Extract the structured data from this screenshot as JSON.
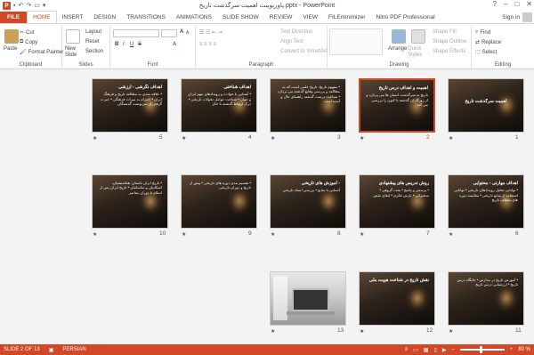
{
  "titlebar": {
    "title": "پاورپوینت اهمیت سرگذشت تاریخ.pptx - PowerPoint",
    "logo": "P",
    "buttons": [
      "?",
      "–",
      "□",
      "✕"
    ]
  },
  "tabs": [
    "FILE",
    "HOME",
    "INSERT",
    "DESIGN",
    "TRANSITIONS",
    "ANIMATIONS",
    "SLIDE SHOW",
    "REVIEW",
    "VIEW",
    "FILEminimizer",
    "Nitro PDF Professional"
  ],
  "active_tab": "HOME",
  "signin": "Sign in",
  "ribbon": {
    "clipboard": {
      "paste": "Paste",
      "cut": "Cut",
      "copy": "Copy",
      "format_painter": "Format Painter",
      "label": "Clipboard"
    },
    "slides": {
      "new_slide": "New Slide",
      "layout": "Layout",
      "reset": "Reset",
      "section": "Section",
      "label": "Slides"
    },
    "font": {
      "label": "Font",
      "bold": "B",
      "italic": "I",
      "underline": "U",
      "strike": "S",
      "grow": "A",
      "shrink": "A",
      "clear": "A"
    },
    "paragraph": {
      "text_direction": "Text Direction",
      "align_text": "Align Text",
      "convert_smartart": "Convert to SmartArt",
      "label": "Paragraph"
    },
    "drawing": {
      "arrange": "Arrange",
      "quick_styles": "Quick Styles",
      "shape_fill": "Shape Fill",
      "shape_outline": "Shape Outline",
      "shape_effects": "Shape Effects",
      "label": "Drawing"
    },
    "editing": {
      "find": "Find",
      "replace": "Replace",
      "select": "Select",
      "label": "Editing"
    }
  },
  "slides": [
    {
      "num": "1",
      "type": "cover",
      "title": "اهمیت سرگذشت تاریخ",
      "body": ""
    },
    {
      "num": "2",
      "type": "text",
      "title": "اهمیت و اهداف درس تاریخ",
      "body": "تاریخ به سرگذشت انسان ها می پردازد و از روزگاران گذشته تا کنون را بررسی می کند"
    },
    {
      "num": "3",
      "type": "text",
      "title": "",
      "body": "• مفهوم تاریخ: تاریخ علمی است که به مطالعه و بررسی وقایع گذشته می پردازد • شناخت درست گذشته راهنمای حال و آینده است"
    },
    {
      "num": "4",
      "type": "text",
      "title": "اهداف شناختی",
      "body": "• آشنایی با حوادث و رویدادهای مهم ایران و جهان • شناخت عوامل تحولات تاریخی • درک ارتباط گذشته با حال"
    },
    {
      "num": "5",
      "type": "text",
      "title": "اهداف نگرشی - ارزشی",
      "body": "• علاقه مندی به مطالعه تاریخ و فرهنگ ایران • احترام به میراث فرهنگی • عبرت گرفتن از سرنوشت گذشتگان"
    },
    {
      "num": "6",
      "type": "text",
      "title": "اهداف مهارتی - محتوایی",
      "body": "• توانایی تحلیل رویدادهای تاریخی • توانایی استفاده از منابع تاریخی • مقایسه دوره های مختلف تاریخ"
    },
    {
      "num": "7",
      "type": "text",
      "title": "روش تدریس های پیشنهادی",
      "body": "• پرسش و پاسخ • بحث گروهی • سخنرانی • بارش فکری • ایفای نقش"
    },
    {
      "num": "8",
      "type": "text",
      "title": "- آموزش های تاریخی",
      "body": "آشنایی با منابع • بررسی اسناد تاریخی"
    },
    {
      "num": "9",
      "type": "text",
      "title": "",
      "body": "• تقسیم بندی دوره های تاریخی • پیش از تاریخ و دوران تاریخی"
    },
    {
      "num": "10",
      "type": "text",
      "title": "",
      "body": "• تاریخ ایران باستان: هخامنشیان، اشکانیان و ساسانیان • تاریخ ایران پس از اسلام تا دوران معاصر"
    },
    {
      "num": "11",
      "type": "text",
      "title": "",
      "body": "• آموزش تاریخ در مدارس • جایگاه درس تاریخ • ارزشیابی درس تاریخ"
    },
    {
      "num": "12",
      "type": "text",
      "title": "نقش تاریخ در شناخت هویت ملی",
      "body": ""
    },
    {
      "num": "13",
      "type": "photo",
      "title": "",
      "body": ""
    }
  ],
  "selected_slide": "2",
  "statusbar": {
    "slide_info": "SLIDE 2 OF 13",
    "language": "PERSIAN",
    "zoom": "80 %"
  },
  "colors": {
    "accent": "#d24726",
    "selection_border": "#d24726"
  }
}
